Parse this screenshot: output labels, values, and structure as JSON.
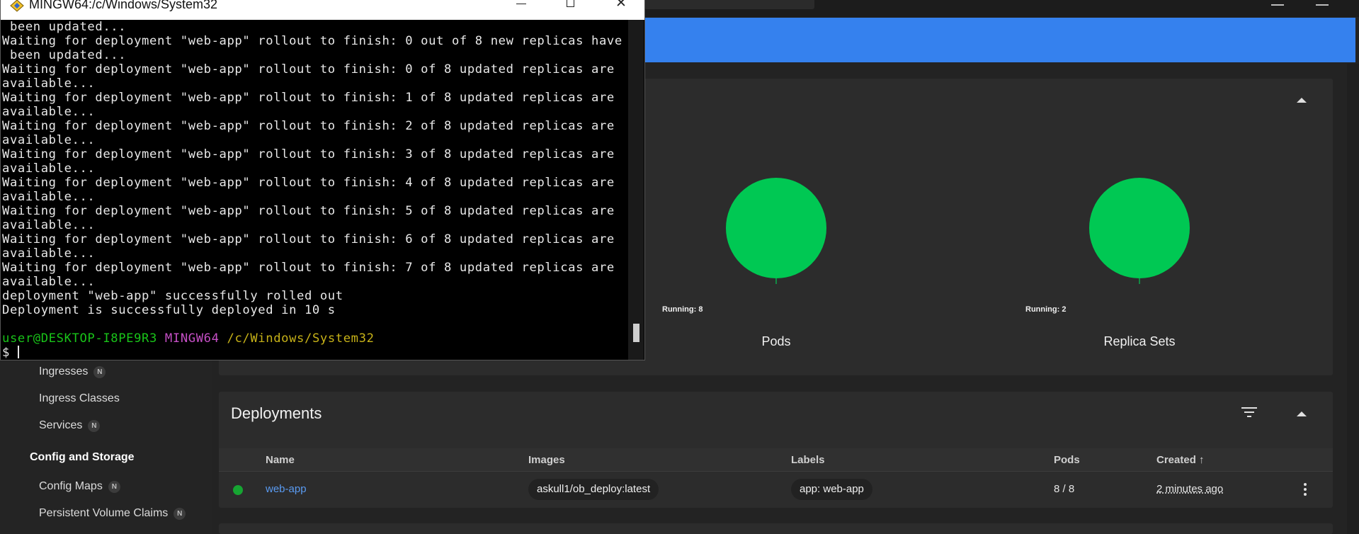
{
  "terminal": {
    "title": "MINGW64:/c/Windows/System32",
    "lines": [
      " been updated...",
      "Waiting for deployment \"web-app\" rollout to finish: 0 out of 8 new replicas have",
      " been updated...",
      "Waiting for deployment \"web-app\" rollout to finish: 0 of 8 updated replicas are",
      "available...",
      "Waiting for deployment \"web-app\" rollout to finish: 1 of 8 updated replicas are",
      "available...",
      "Waiting for deployment \"web-app\" rollout to finish: 2 of 8 updated replicas are",
      "available...",
      "Waiting for deployment \"web-app\" rollout to finish: 3 of 8 updated replicas are",
      "available...",
      "Waiting for deployment \"web-app\" rollout to finish: 4 of 8 updated replicas are",
      "available...",
      "Waiting for deployment \"web-app\" rollout to finish: 5 of 8 updated replicas are",
      "available...",
      "Waiting for deployment \"web-app\" rollout to finish: 6 of 8 updated replicas are",
      "available...",
      "Waiting for deployment \"web-app\" rollout to finish: 7 of 8 updated replicas are",
      "available...",
      "deployment \"web-app\" successfully rolled out",
      "Deployment is successfully deployed in 10 s",
      ""
    ],
    "prompt_user": "user@DESKTOP-I8PE9R3",
    "prompt_shell": "MINGW64",
    "prompt_path": "/c/Windows/System32",
    "prompt_symbol": "$"
  },
  "sidebar": {
    "items": [
      {
        "label": "Ingresses",
        "badge": "N"
      },
      {
        "label": "Ingress Classes"
      },
      {
        "label": "Services",
        "badge": "N"
      }
    ],
    "section_heading": "Config and Storage",
    "storage_items": [
      {
        "label": "Config Maps",
        "badge": "N"
      },
      {
        "label": "Persistent Volume Claims",
        "badge": "N"
      }
    ]
  },
  "workload_status": {
    "charts": [
      {
        "title": "Pods",
        "legend": "Running: 8",
        "color": "#00c853"
      },
      {
        "title": "Replica Sets",
        "legend": "Running: 2",
        "color": "#00c853"
      }
    ]
  },
  "deployments": {
    "title": "Deployments",
    "columns": {
      "name": "Name",
      "images": "Images",
      "labels": "Labels",
      "pods": "Pods",
      "created": "Created ↑"
    },
    "rows": [
      {
        "name": "web-app",
        "image": "askull1/ob_deploy:latest",
        "label": "app: web-app",
        "pods": "8 / 8",
        "created": "2 minutes ago",
        "status_color": "#16a532"
      }
    ]
  },
  "colors": {
    "banner": "#3581ee",
    "link": "#5a9bf2",
    "running": "#00c853"
  }
}
